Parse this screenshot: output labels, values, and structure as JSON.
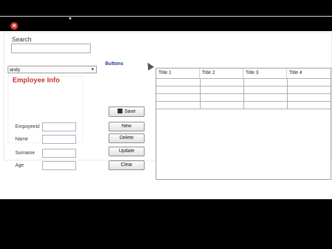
{
  "search": {
    "label": "Search",
    "value": ""
  },
  "combo": {
    "value": "andy"
  },
  "employee": {
    "title": "Employee Info",
    "fields": [
      {
        "label": "Empoyeeid",
        "value": ""
      },
      {
        "label": "Name",
        "value": ""
      },
      {
        "label": "Surname",
        "value": ""
      },
      {
        "label": "Age",
        "value": ""
      }
    ]
  },
  "buttons": {
    "title": "Buttons",
    "save": "Save",
    "new": "New",
    "delete": "Delete",
    "update": "Update",
    "clear": "Clear"
  },
  "grid": {
    "columns": [
      "Title 1",
      "Title 2",
      "Title 3",
      "Title 4"
    ]
  }
}
